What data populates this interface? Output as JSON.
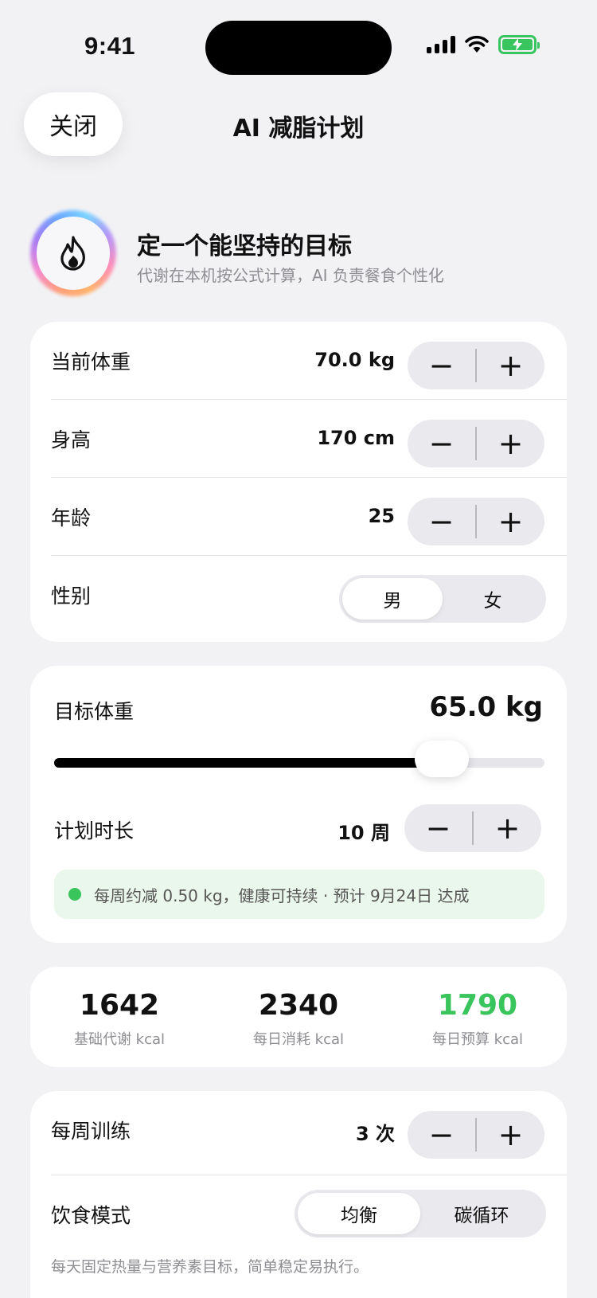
{
  "status": {
    "time": "9:41"
  },
  "nav": {
    "close_label": "关闭",
    "title": "AI 减脂计划"
  },
  "hero": {
    "title": "定一个能坚持的目标",
    "subtitle": "代谢在本机按公式计算，AI 负责餐食个性化",
    "icon": "flame-icon"
  },
  "profile": {
    "weight": {
      "label": "当前体重",
      "value": "70.0 kg"
    },
    "height": {
      "label": "身高",
      "value": "170 cm"
    },
    "age": {
      "label": "年龄",
      "value": "25"
    },
    "gender": {
      "label": "性别",
      "options": [
        "男",
        "女"
      ],
      "selected": "男"
    }
  },
  "stepper": {
    "minus": "−",
    "plus": "+"
  },
  "goal": {
    "target_label": "目标体重",
    "target_value": "65.0 kg",
    "slider_fraction": 0.79,
    "duration_label": "计划时长",
    "duration_value": "10 周",
    "info": "每周约减 0.50 kg，健康可持续 · 预计 9月24日 达成"
  },
  "stats": [
    {
      "value": "1642",
      "label": "基础代谢 kcal",
      "color": "#111111"
    },
    {
      "value": "2340",
      "label": "每日消耗 kcal",
      "color": "#111111"
    },
    {
      "value": "1790",
      "label": "每日预算 kcal",
      "color": "#39c45c"
    }
  ],
  "training": {
    "label": "每周训练",
    "value": "3 次",
    "diet_label": "饮食模式",
    "diet_options": [
      "均衡",
      "碳循环"
    ],
    "diet_selected": "均衡",
    "footnote": "每天固定热量与营养素目标，简单稳定易执行。"
  },
  "colors": {
    "accent_green": "#39c45c",
    "background": "#f2f2f5"
  }
}
